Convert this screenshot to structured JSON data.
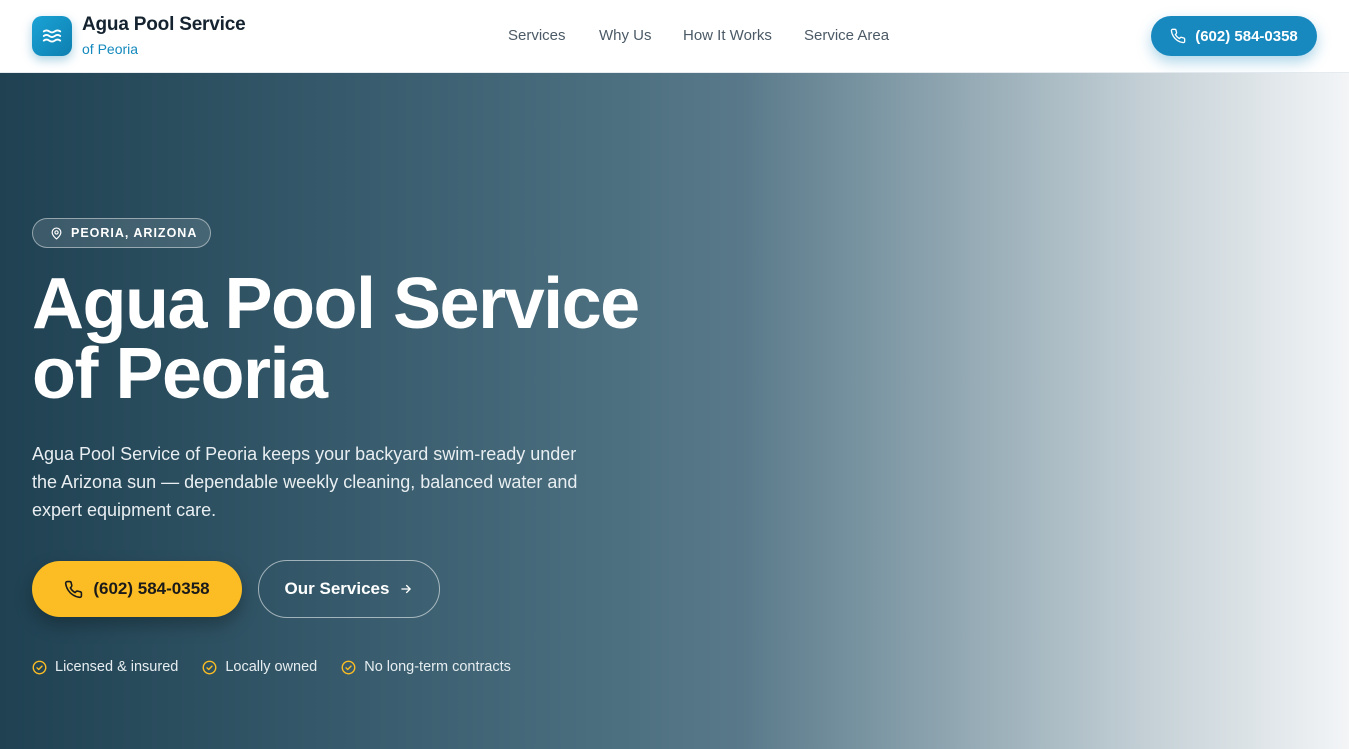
{
  "header": {
    "brand_title": "Agua Pool Service",
    "brand_subtitle": "of Peoria",
    "logo_icon": "waves-icon",
    "nav": [
      "Services",
      "Why Us",
      "How It Works",
      "Service Area"
    ],
    "call_label": "(602) 584-0358"
  },
  "hero": {
    "badge": "PEORIA, ARIZONA",
    "title_line1": "Agua Pool Service",
    "title_line2": "of Peoria",
    "description": "Agua Pool Service of Peoria keeps your backyard swim-ready under the Arizona sun — dependable weekly cleaning, balanced water and expert equipment care.",
    "primary_button": "(602) 584-0358",
    "secondary_button": "Our Services",
    "trust": [
      "Licensed & insured",
      "Locally owned",
      "No long-term contracts"
    ]
  },
  "colors": {
    "accent": "#1789bf",
    "cta": "#fbbd23",
    "hero_dark": "#1f4152",
    "check": "#fbbd23"
  }
}
